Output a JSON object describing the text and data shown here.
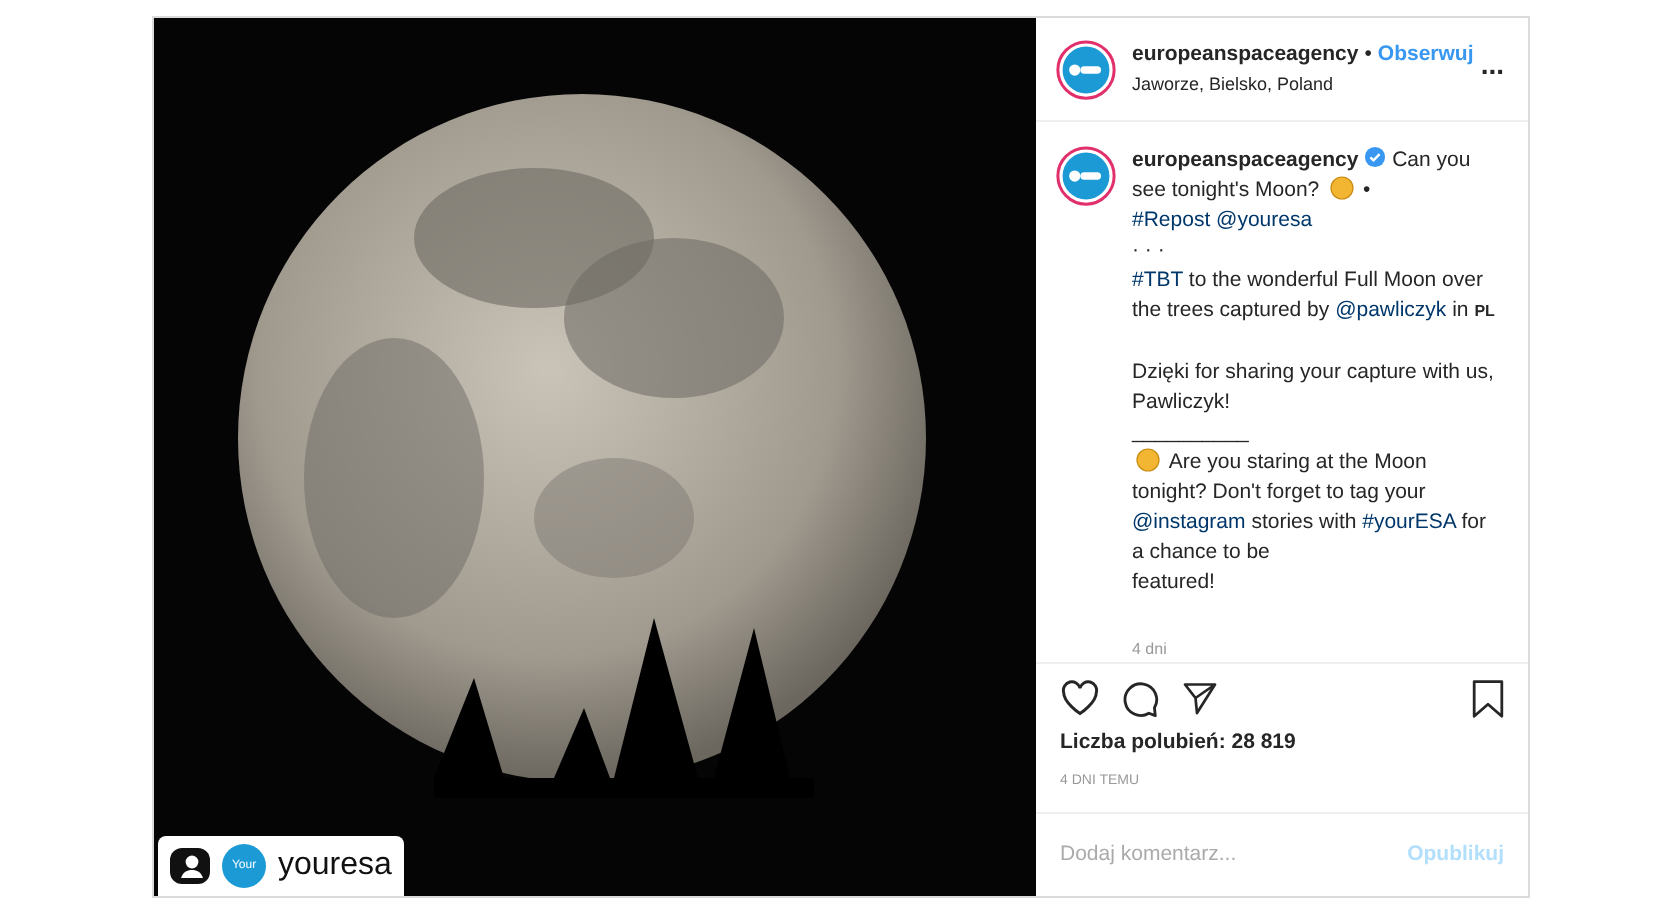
{
  "photo_tag": {
    "username": "youresa",
    "badge_text": "Your"
  },
  "header": {
    "username": "europeanspaceagency",
    "follow": "Obserwuj",
    "separator": "•",
    "location": "Jaworze, Bielsko, Poland",
    "more": "..."
  },
  "caption": {
    "username": "europeanspaceagency",
    "verified": true,
    "paragraphs": [
      [
        {
          "kind": "text",
          "text": "Can you see tonight's Moon?"
        },
        {
          "kind": "emoji"
        },
        {
          "kind": "text",
          "text": "•"
        }
      ],
      [
        {
          "kind": "link",
          "text": "#Repost"
        },
        {
          "kind": "link",
          "text": "@youresa"
        }
      ],
      [
        {
          "kind": "text",
          "text": "· · ·"
        }
      ],
      [
        {
          "kind": "link",
          "text": "#TBT"
        },
        {
          "kind": "text",
          "text": "to the wonderful Full Moon over the trees captured by"
        },
        {
          "kind": "link",
          "text": "@pawliczyk"
        },
        {
          "kind": "text",
          "text": "in"
        },
        {
          "kind": "small",
          "text": "PL"
        }
      ],
      [
        {
          "kind": "gap"
        }
      ],
      [
        {
          "kind": "text",
          "text": "Dzięki for sharing your capture with us, Pawliczyk!"
        }
      ],
      [
        {
          "kind": "text",
          "text": "__________"
        }
      ],
      [
        {
          "kind": "emoji"
        },
        {
          "kind": "text",
          "text": "Are you staring at the Moon tonight? Don't forget to tag your"
        },
        {
          "kind": "link",
          "text": "@instagram"
        },
        {
          "kind": "text",
          "text": "stories with"
        },
        {
          "kind": "link",
          "text": "#yourESA"
        },
        {
          "kind": "text",
          "text": "for a chance to be"
        }
      ],
      [
        {
          "kind": "text",
          "text": "featured!"
        }
      ]
    ],
    "age": "4 dni"
  },
  "actions": {
    "liked": false,
    "saved": false
  },
  "likes": "Liczba polubień: 28 819",
  "time": "4 DNI TEMU",
  "comment": {
    "placeholder": "Dodaj komentarz...",
    "submit": "Opublikuj"
  }
}
